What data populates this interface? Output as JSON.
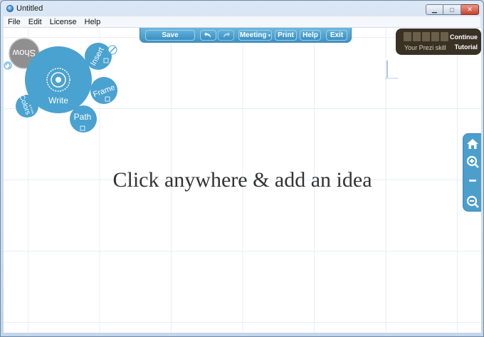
{
  "window": {
    "title": "Untitled",
    "controls": {
      "minimize": "▁",
      "maximize": "□",
      "close": "✕"
    }
  },
  "menubar": {
    "items": [
      "File",
      "Edit",
      "License",
      "Help"
    ]
  },
  "toolbar": {
    "save": "Save",
    "meeting": "Meeting",
    "print": "Print",
    "help": "Help",
    "exit": "Exit"
  },
  "skill_meter": {
    "label": "Your Prezi skill",
    "continue": "Continue",
    "tutorial": "Tutorial",
    "level_filled": 0,
    "level_total": 5
  },
  "zebra_menu": {
    "center": "Write",
    "insert": "Insert",
    "frame": "Frame",
    "path": "Path",
    "colors": "Colors",
    "colors_sub": "& Fonts",
    "show": "Show"
  },
  "canvas": {
    "hint": "Click anywhere & add an idea"
  },
  "zoom_controls": [
    "home-icon",
    "zoom-in-icon",
    "zoom-out-icon"
  ],
  "colors": {
    "accent": "#3f93c1",
    "skill_bg": "#3a3125"
  }
}
